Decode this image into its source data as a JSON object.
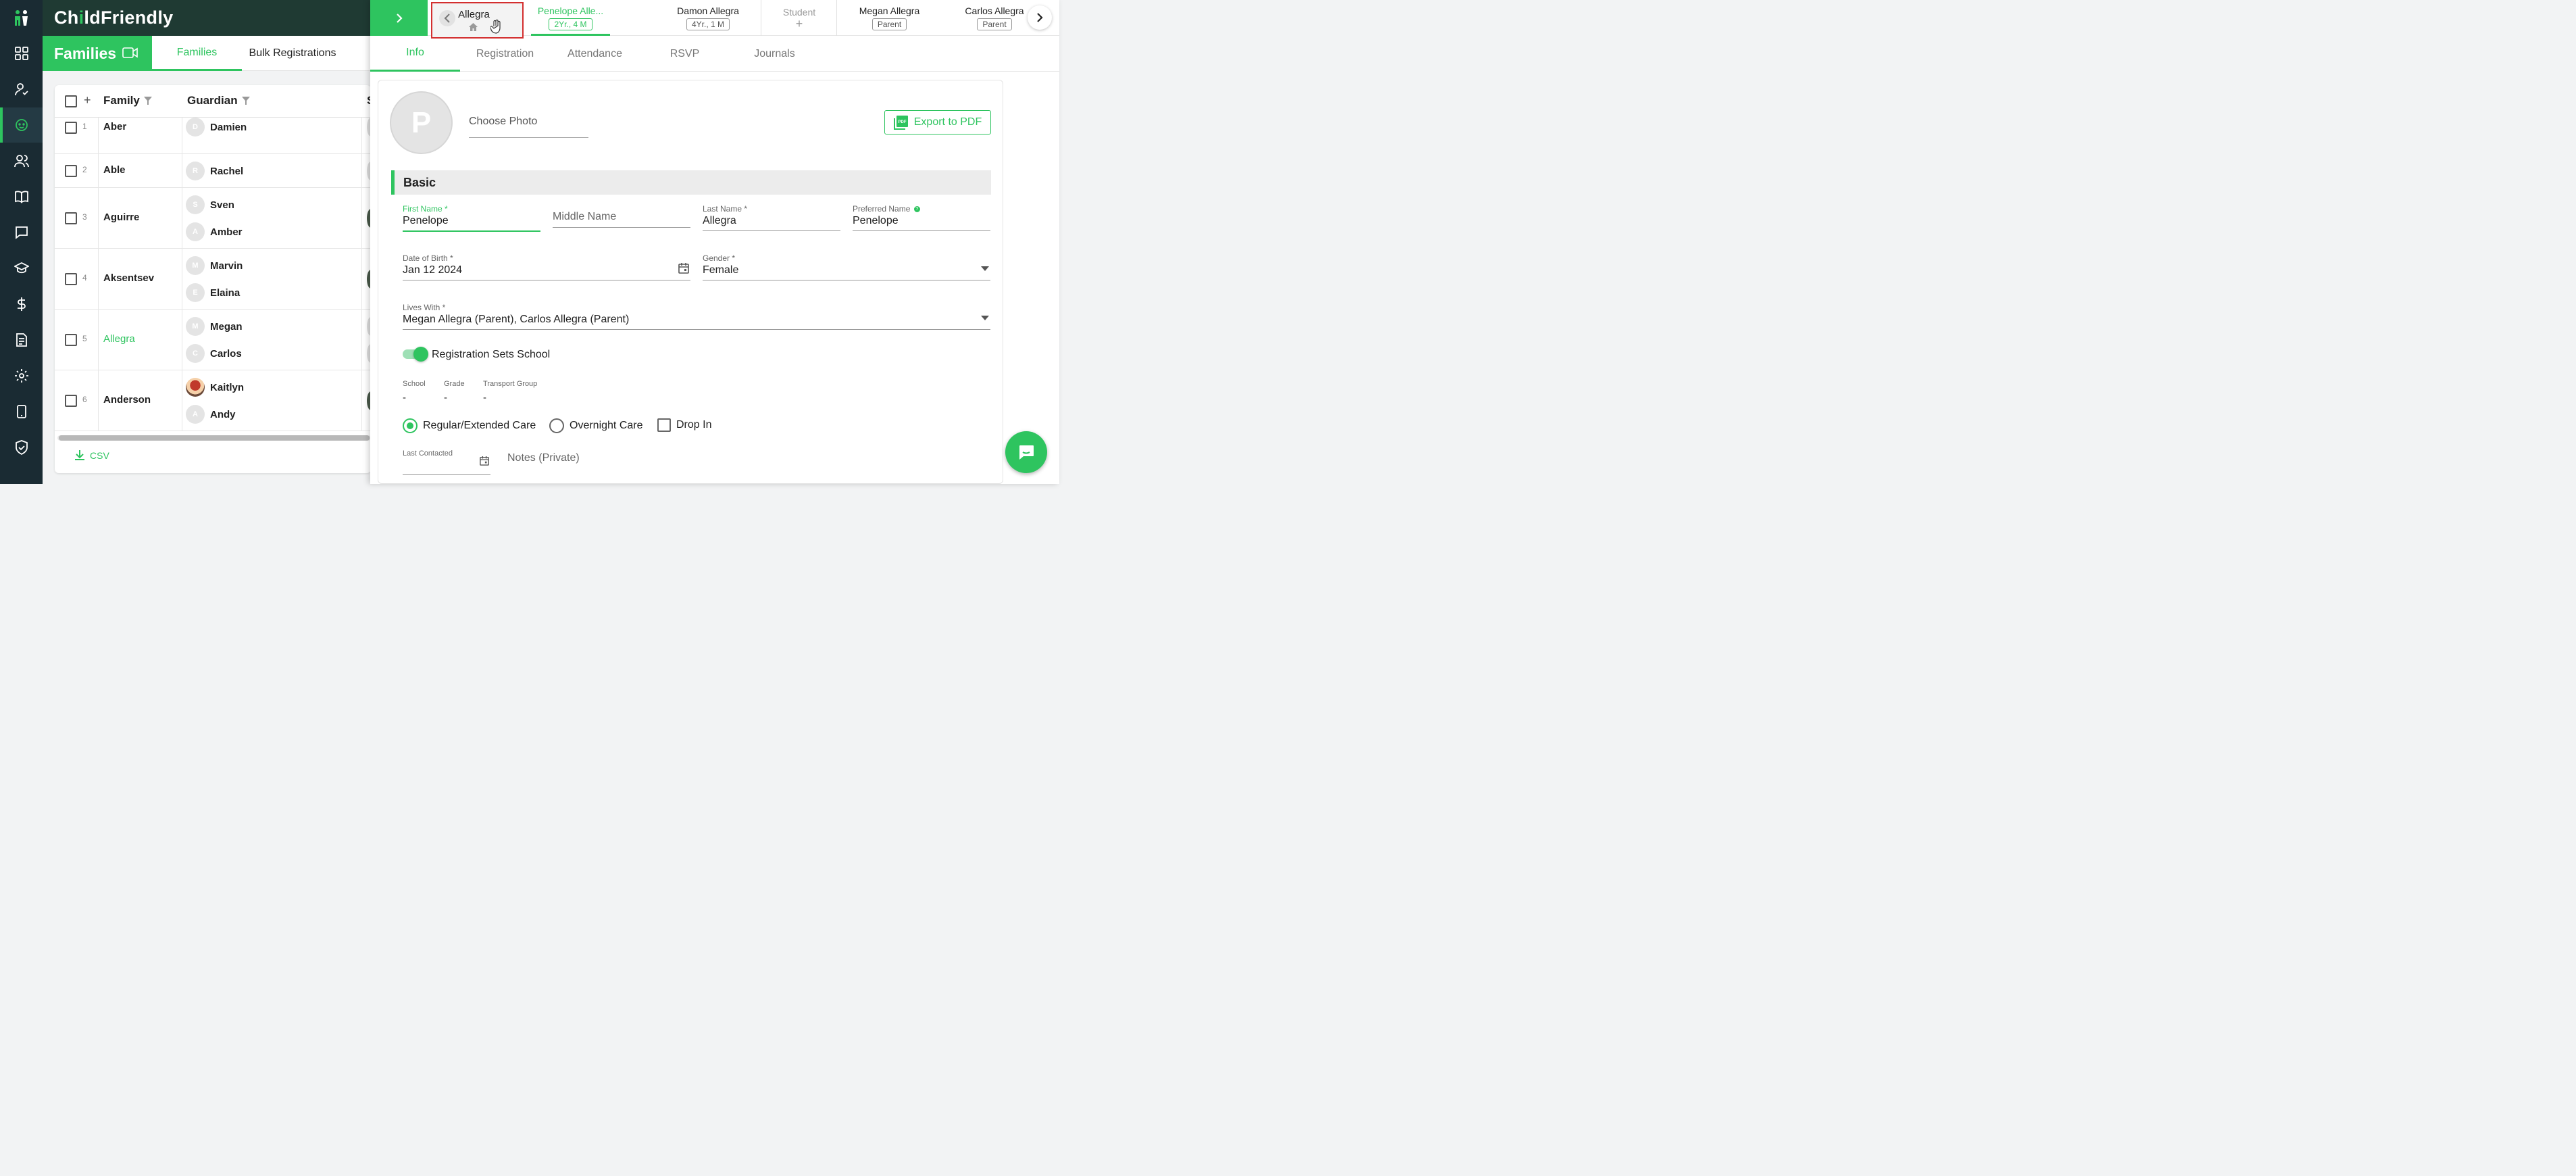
{
  "brand": {
    "name_part1": "Ch",
    "name_i": "i",
    "name_part2": "ld",
    "name_part3": "Friendly"
  },
  "nav": {
    "items": [
      "logo",
      "dashboard",
      "check-in",
      "children",
      "staff",
      "learning",
      "messages",
      "classrooms",
      "billing",
      "reports",
      "settings",
      "tablet",
      "security"
    ],
    "active": "children"
  },
  "families_header": {
    "title": "Families",
    "tabs": [
      "Families",
      "Bulk Registrations"
    ]
  },
  "table": {
    "headers": {
      "family": "Family",
      "guardian": "Guardian",
      "next": "S"
    },
    "rows": [
      {
        "num": "1",
        "family": "Aber",
        "guardians": [
          {
            "initial": "D",
            "name": "Damien"
          }
        ]
      },
      {
        "num": "2",
        "family": "Able",
        "guardians": [
          {
            "initial": "R",
            "name": "Rachel"
          }
        ]
      },
      {
        "num": "3",
        "family": "Aguirre",
        "guardians": [
          {
            "initial": "S",
            "name": "Sven"
          },
          {
            "initial": "A",
            "name": "Amber"
          }
        ]
      },
      {
        "num": "4",
        "family": "Aksentsev",
        "guardians": [
          {
            "initial": "M",
            "name": "Marvin"
          },
          {
            "initial": "E",
            "name": "Elaina"
          }
        ]
      },
      {
        "num": "5",
        "family": "Allegra",
        "guardians": [
          {
            "initial": "M",
            "name": "Megan"
          },
          {
            "initial": "C",
            "name": "Carlos"
          }
        ]
      },
      {
        "num": "6",
        "family": "Anderson",
        "guardians": [
          {
            "initial": "",
            "name": "Kaitlyn"
          },
          {
            "initial": "A",
            "name": "Andy"
          }
        ]
      }
    ],
    "csv_label": "CSV"
  },
  "drawer": {
    "family_chip": "Allegra",
    "people": [
      {
        "name": "Penelope Alle...",
        "badge": "2Yr., 4 M"
      },
      {
        "name": "Damon Allegra",
        "badge": "4Yr., 1 M"
      },
      {
        "name": "Student",
        "badge": "+"
      },
      {
        "name": "Megan Allegra",
        "badge": "Parent"
      },
      {
        "name": "Carlos Allegra",
        "badge": "Parent"
      }
    ],
    "tabs": [
      "Info",
      "Registration",
      "Attendance",
      "RSVP",
      "Journals"
    ],
    "active_tab": "Info"
  },
  "form": {
    "avatar_initial": "P",
    "choose_photo": "Choose Photo",
    "export_label": "Export to PDF",
    "section": "Basic",
    "first_name": {
      "label": "First Name *",
      "value": "Penelope"
    },
    "middle_name": {
      "label": "Middle Name"
    },
    "last_name": {
      "label": "Last Name *",
      "value": "Allegra"
    },
    "preferred_name": {
      "label": "Preferred Name",
      "value": "Penelope"
    },
    "dob": {
      "label": "Date of Birth *",
      "value": "Jan 12 2024"
    },
    "gender": {
      "label": "Gender *",
      "value": "Female"
    },
    "lives_with": {
      "label": "Lives With *",
      "value": "Megan Allegra (Parent), Carlos Allegra (Parent)"
    },
    "toggle_label": "Registration Sets School",
    "school": {
      "label": "School",
      "value": "-"
    },
    "grade": {
      "label": "Grade",
      "value": "-"
    },
    "transport": {
      "label": "Transport Group",
      "value": "-"
    },
    "care_options": [
      "Regular/Extended Care",
      "Overnight Care",
      "Drop In"
    ],
    "last_contacted": {
      "label": "Last Contacted"
    },
    "notes": {
      "label": "Notes (Private)"
    }
  },
  "colors": {
    "accent": "#2ec45f",
    "rail": "#1a2b33",
    "brandbar": "#1f3a33",
    "highlight": "#d32f2f"
  }
}
